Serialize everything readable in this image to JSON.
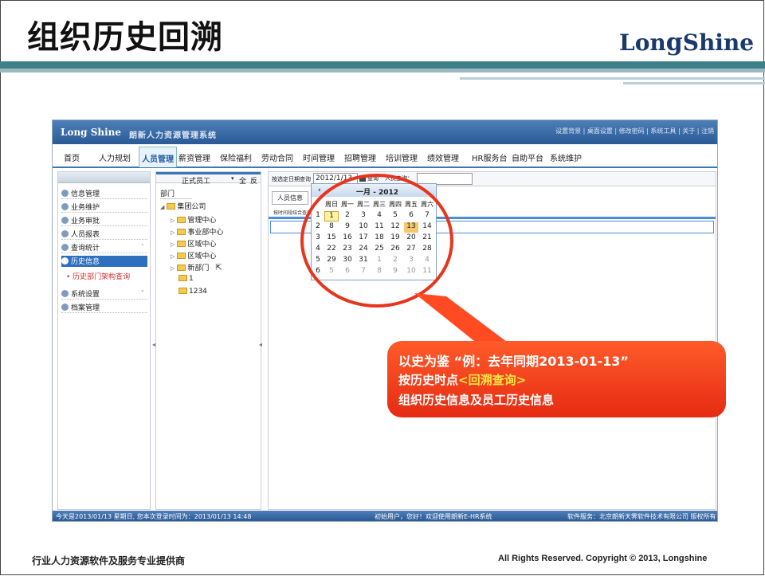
{
  "slide": {
    "title": "组织历史回溯",
    "logo_left": "Lon",
    "logo_mid": "g",
    "logo_right": "Shine",
    "footer_left": "行业人力资源软件及服务专业提供商",
    "footer_right": "All Rights Reserved. Copyright © 2013, Longshine"
  },
  "app": {
    "logo": "Long Shine",
    "name": "朗新人力资源管理系统",
    "top_links": "设置背景 | 桌面设置 | 修改密码 | 系统工具 | 关于 | 注销",
    "menu": [
      "首页",
      "人力规划",
      "人员管理",
      "薪资管理",
      "保险福利",
      "劳动合同",
      "时间管理",
      "招聘管理",
      "培训管理",
      "绩效管理",
      "HR服务台",
      "自助平台",
      "系统维护"
    ],
    "menu_active_index": 2,
    "left_panel": {
      "items": [
        "信息管理",
        "业务维护",
        "业务审批",
        "人员报表",
        "查询统计",
        "历史信息",
        "系统设置",
        "档案管理"
      ],
      "active": "历史信息",
      "sub_item": "历史部门架构查询"
    },
    "tree_panel": {
      "employee_type": "正式员工",
      "btn_all": "全",
      "btn_invert": "反",
      "dept_label": "部门",
      "nodes": [
        "集团公司",
        "管理中心",
        "事业部中心",
        "区域中心",
        "区域中心",
        "新部门",
        "1",
        "1234"
      ]
    },
    "main_panel": {
      "date_label": "按选定日期查询",
      "date_value": "2012/1/13",
      "query_label": "查询",
      "name_label": "人员查询：",
      "tab": "人员信息",
      "sub_label": "按时间段结合查询"
    },
    "status": {
      "left": "今天是2013/01/13 星期日, 您本次登录时间为：2013/01/13 14:48",
      "middle": "初始用户，您好！欢迎使用朗新E-HR系统",
      "right": "软件服务：北京朗新天霁软件技术有限公司 版权所有"
    }
  },
  "calendar": {
    "prev": "‹",
    "title": "一月 - 2012",
    "weekdays": [
      "周日",
      "周一",
      "周二",
      "周三",
      "周四",
      "周五",
      "周六"
    ],
    "weeks": [
      {
        "wk": "1",
        "days": [
          "1",
          "2",
          "3",
          "4",
          "5",
          "6",
          "7"
        ]
      },
      {
        "wk": "2",
        "days": [
          "8",
          "9",
          "10",
          "11",
          "12",
          "13",
          "14"
        ]
      },
      {
        "wk": "3",
        "days": [
          "15",
          "16",
          "17",
          "18",
          "19",
          "20",
          "21"
        ]
      },
      {
        "wk": "4",
        "days": [
          "22",
          "23",
          "24",
          "25",
          "26",
          "27",
          "28"
        ]
      },
      {
        "wk": "5",
        "days": [
          "29",
          "30",
          "31",
          "1",
          "2",
          "3",
          "4"
        ]
      },
      {
        "wk": "6",
        "days": [
          "5",
          "6",
          "7",
          "8",
          "9",
          "10",
          "11"
        ]
      }
    ],
    "today": "1",
    "selected": "13"
  },
  "callout": {
    "line1": "以史为鉴 “例：去年同期2013-01-13”",
    "line2a": "按历史时点",
    "line2b": "<回溯查询>",
    "line3": "组织历史信息及员工历史信息"
  },
  "colors": {
    "accent": "#3b76b5",
    "callout": "#e52b12",
    "highlight": "#ffe642",
    "circle": "#e8341c"
  }
}
